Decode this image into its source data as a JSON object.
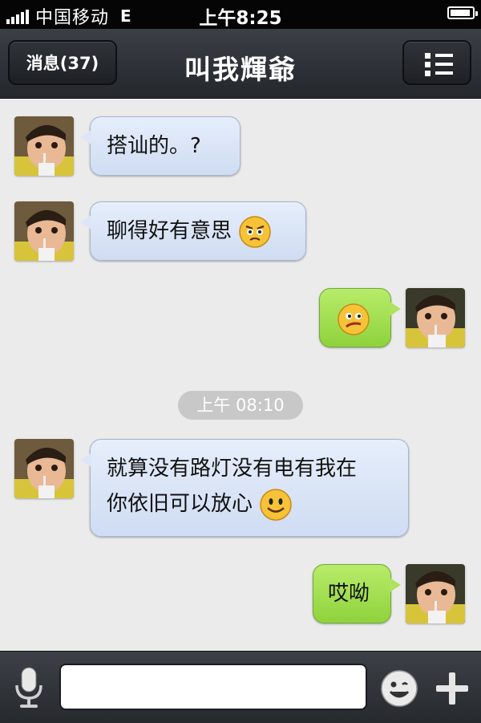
{
  "status_bar": {
    "carrier": "中国移动",
    "network": "E",
    "time": "上午8:25"
  },
  "nav": {
    "back_label": "消息(37)",
    "title": "叫我輝爺",
    "menu_icon": "list-icon"
  },
  "messages": [
    {
      "direction": "incoming",
      "text": "搭讪的。?",
      "emoji": null
    },
    {
      "direction": "incoming",
      "text": "聊得好有意思",
      "emoji": "frowning-face"
    },
    {
      "direction": "outgoing",
      "text": "",
      "emoji": "smirking-face"
    },
    {
      "direction": "incoming",
      "text_line1": "就算没有路灯没有电有我在",
      "text_line2": "你依旧可以放心",
      "emoji": "smiling-face"
    },
    {
      "direction": "outgoing",
      "text": "哎呦",
      "emoji": null
    }
  ],
  "timestamp": "上午 08:10",
  "input_bar": {
    "voice_icon": "microphone-icon",
    "input_value": "",
    "emoji_icon": "smiley-icon",
    "more_icon": "plus-icon"
  },
  "colors": {
    "incoming_bubble": "#dce6f7",
    "outgoing_bubble": "#a5e155",
    "nav_bg": "#2e3137"
  }
}
